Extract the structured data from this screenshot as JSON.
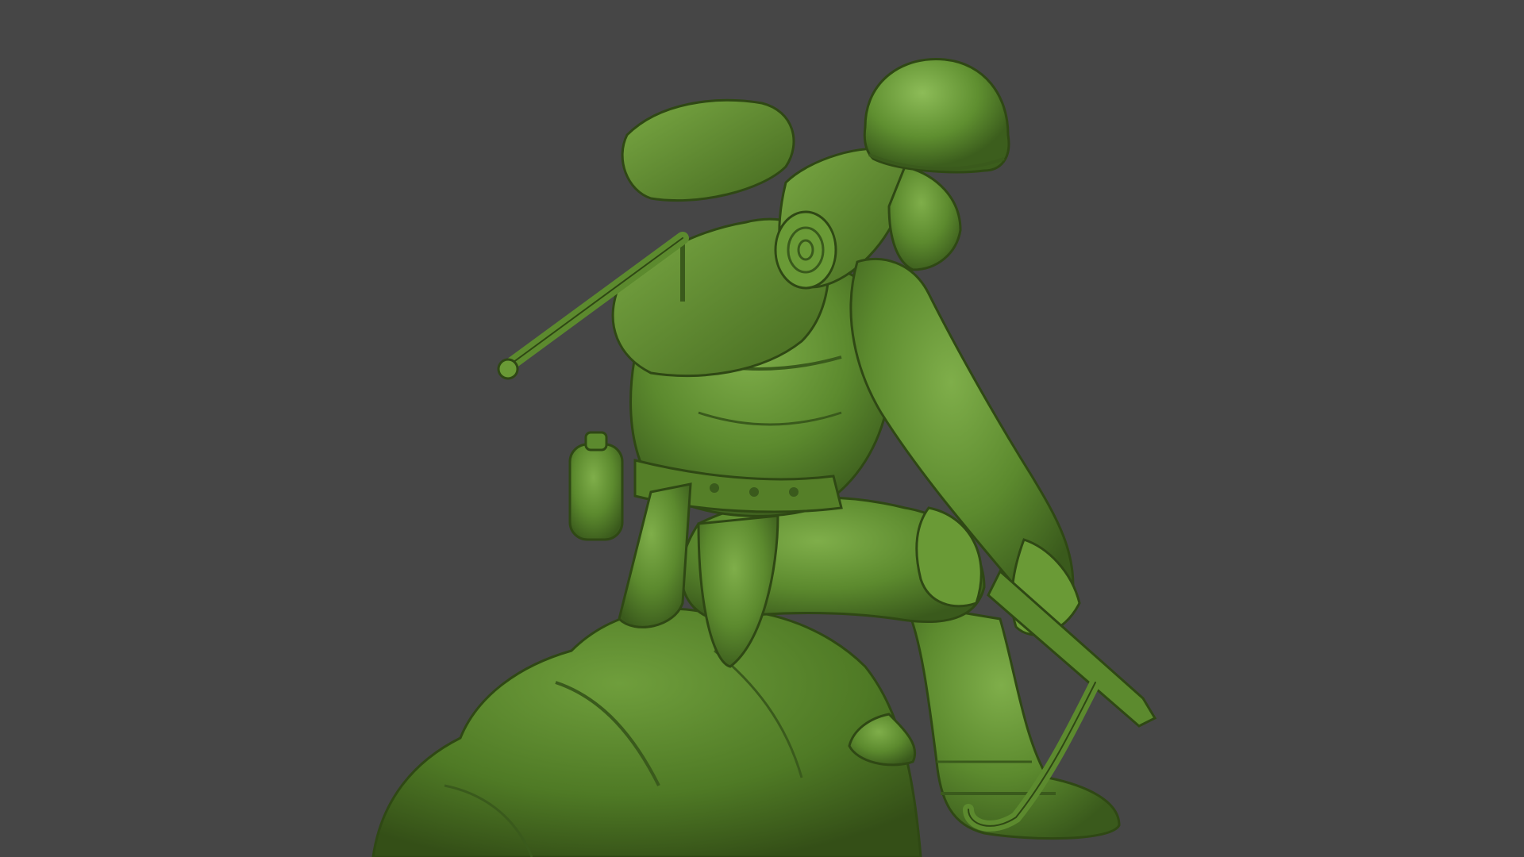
{
  "viewport": {
    "background_color": "#464646"
  },
  "model": {
    "subject": "toy-soldier-kneeling-on-rock",
    "base_color": "#5c8a2e",
    "highlight_color": "#7fae4a",
    "shadow_color": "#3a5a1c"
  }
}
